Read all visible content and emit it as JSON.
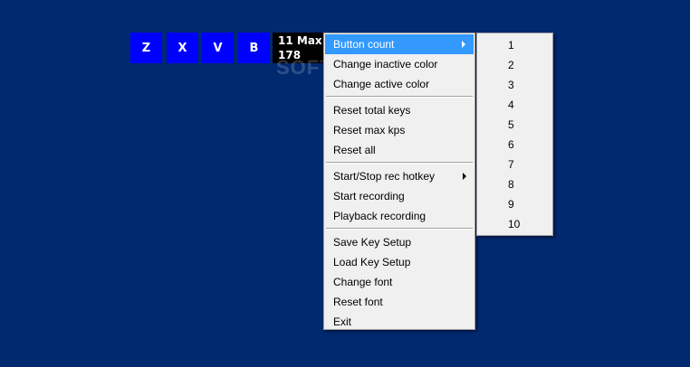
{
  "keys": [
    {
      "label": "Z"
    },
    {
      "label": "X"
    },
    {
      "label": "V"
    },
    {
      "label": "B"
    }
  ],
  "kps_panel": {
    "line1": "11 Max",
    "line2": "178"
  },
  "watermark": "SOFTPEDIA",
  "main_menu": {
    "groups": [
      [
        {
          "label": "Button count",
          "submenu": true,
          "highlighted": true
        },
        {
          "label": "Change inactive color"
        },
        {
          "label": "Change active color"
        }
      ],
      [
        {
          "label": "Reset total keys"
        },
        {
          "label": "Reset max kps"
        },
        {
          "label": "Reset all"
        }
      ],
      [
        {
          "label": "Start/Stop rec hotkey",
          "submenu": true
        },
        {
          "label": "Start recording"
        },
        {
          "label": "Playback recording"
        }
      ],
      [
        {
          "label": "Save Key Setup"
        },
        {
          "label": "Load Key Setup"
        },
        {
          "label": "Change font"
        },
        {
          "label": "Reset font"
        },
        {
          "label": "Exit"
        }
      ]
    ]
  },
  "button_count_submenu": {
    "items": [
      "1",
      "2",
      "3",
      "4",
      "5",
      "6",
      "7",
      "8",
      "9",
      "10"
    ]
  },
  "colors": {
    "desktop_bg": "#012970",
    "key_bg": "#0000ff",
    "menu_bg": "#f0f0f0",
    "highlight": "#3399ff"
  }
}
